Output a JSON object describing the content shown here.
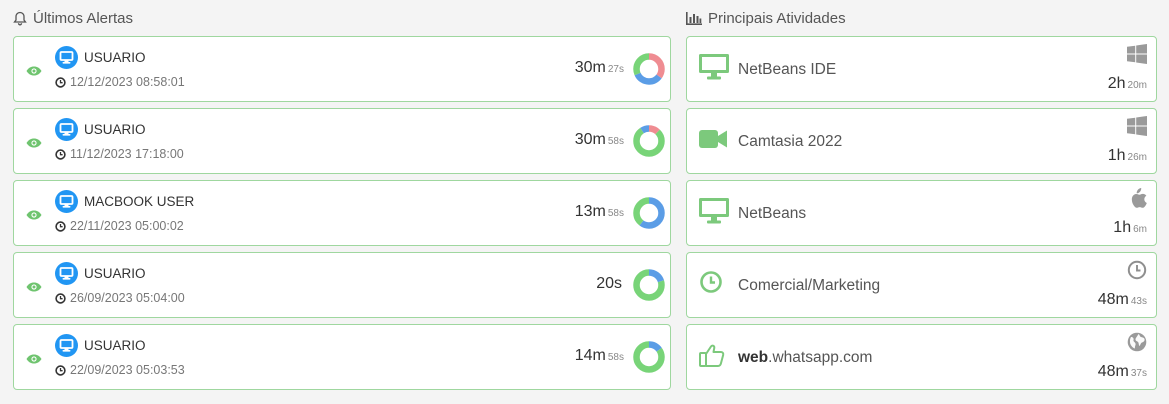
{
  "alerts_panel": {
    "title": "Últimos Alertas",
    "items": [
      {
        "user": "USUARIO",
        "date": "12/12/2023 08:58:01",
        "duration_main": "30m",
        "duration_sub": "27s",
        "donut": [
          {
            "color": "#ef8c92",
            "value": 0.35
          },
          {
            "color": "#5b9de6",
            "value": 0.33
          },
          {
            "color": "#78d478",
            "value": 0.32
          }
        ]
      },
      {
        "user": "USUARIO",
        "date": "11/12/2023 17:18:00",
        "duration_main": "30m",
        "duration_sub": "58s",
        "donut": [
          {
            "color": "#ef8c92",
            "value": 0.12
          },
          {
            "color": "#78d478",
            "value": 0.78
          },
          {
            "color": "#5b9de6",
            "value": 0.1
          }
        ]
      },
      {
        "user": "MACBOOK USER",
        "date": "22/11/2023 05:00:02",
        "duration_main": "13m",
        "duration_sub": "58s",
        "donut": [
          {
            "color": "#5b9de6",
            "value": 0.6
          },
          {
            "color": "#78d478",
            "value": 0.4
          }
        ]
      },
      {
        "user": "USUARIO",
        "date": "26/09/2023 05:04:00",
        "duration_main": "20s",
        "duration_sub": "",
        "donut": [
          {
            "color": "#5b9de6",
            "value": 0.2
          },
          {
            "color": "#78d478",
            "value": 0.8
          }
        ]
      },
      {
        "user": "USUARIO",
        "date": "22/09/2023 05:03:53",
        "duration_main": "14m",
        "duration_sub": "58s",
        "donut": [
          {
            "color": "#5b9de6",
            "value": 0.15
          },
          {
            "color": "#78d478",
            "value": 0.85
          }
        ]
      }
    ]
  },
  "activities_panel": {
    "title": "Principais Atividades",
    "items": [
      {
        "icon": "monitor-icon",
        "name_bold": "",
        "name": "NetBeans IDE",
        "os": "windows-icon",
        "duration_main": "2h",
        "duration_sub": "20m"
      },
      {
        "icon": "video-camera-icon",
        "name_bold": "",
        "name": "Camtasia 2022",
        "os": "windows-icon",
        "duration_main": "1h",
        "duration_sub": "26m"
      },
      {
        "icon": "monitor-icon",
        "name_bold": "",
        "name": "NetBeans",
        "os": "apple-icon",
        "duration_main": "1h",
        "duration_sub": "6m"
      },
      {
        "icon": "clock-icon",
        "name_bold": "",
        "name": "Comercial/Marketing",
        "os": "clock-icon",
        "duration_main": "48m",
        "duration_sub": "43s"
      },
      {
        "icon": "thumbs-up-icon",
        "name_bold": "web",
        "name": ".whatsapp.com",
        "os": "globe-icon",
        "duration_main": "48m",
        "duration_sub": "37s"
      }
    ]
  },
  "colors": {
    "accent_green": "#7cc97c",
    "device_blue": "#2196f3",
    "card_border": "#9fd79f"
  }
}
